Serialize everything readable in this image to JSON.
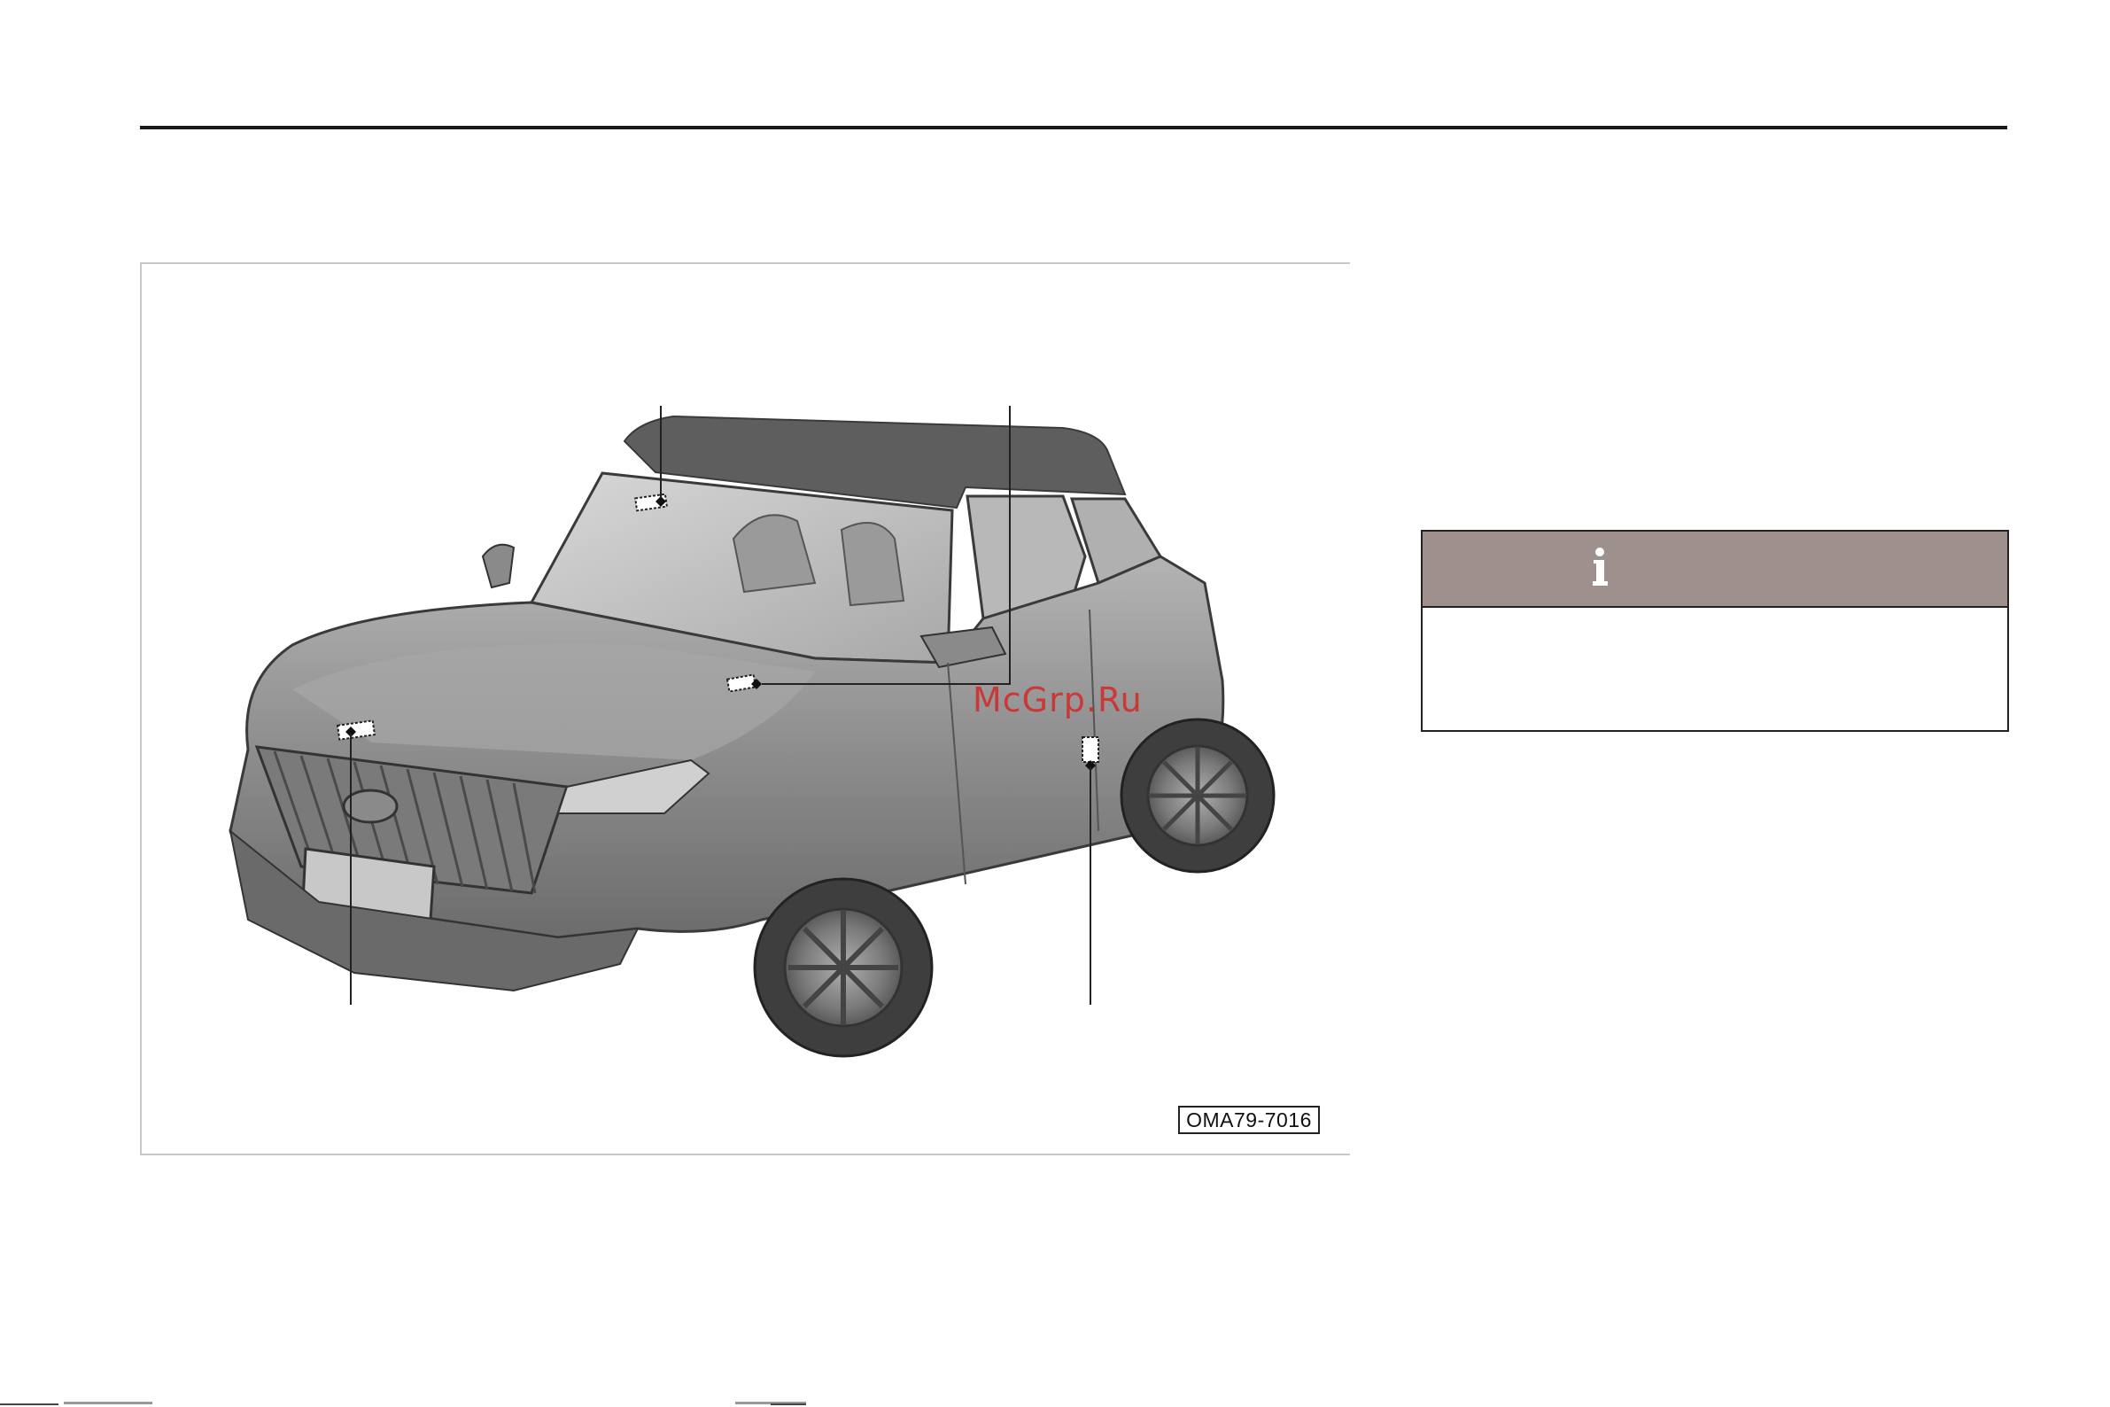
{
  "figure": {
    "code": "OMA79-7016",
    "watermark": "McGrp.Ru"
  },
  "info_box": {
    "icon": "info-icon"
  },
  "colors": {
    "info_header": "#9e918d",
    "car_body": "#8c8c8c",
    "watermark": "#d22828"
  }
}
